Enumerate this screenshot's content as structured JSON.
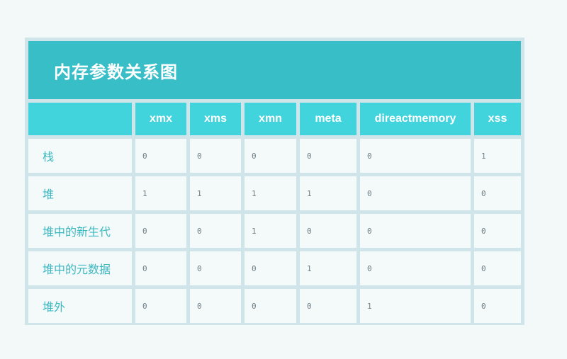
{
  "title": "内存参数关系图",
  "table": {
    "corner": "",
    "columns": [
      "xmx",
      "xms",
      "xmn",
      "meta",
      "direactmemory",
      "xss"
    ],
    "rows": [
      {
        "label": "栈",
        "values": [
          "0",
          "0",
          "0",
          "0",
          "0",
          "1"
        ]
      },
      {
        "label": "堆",
        "values": [
          "1",
          "1",
          "1",
          "1",
          "0",
          "0"
        ]
      },
      {
        "label": "堆中的新生代",
        "values": [
          "0",
          "0",
          "1",
          "0",
          "0",
          "0"
        ]
      },
      {
        "label": "堆中的元数据",
        "values": [
          "0",
          "0",
          "0",
          "1",
          "0",
          "0"
        ]
      },
      {
        "label": "堆外",
        "values": [
          "0",
          "0",
          "0",
          "0",
          "1",
          "0"
        ]
      }
    ]
  },
  "colors": {
    "page_background": "#f3f8f9",
    "title_bar": "#38bec6",
    "header_cells": "#41d4dd",
    "body_cells": "#f4f9fa",
    "grid_lines": "#cfe5ea",
    "row_label_text": "#3cb8c1",
    "value_text": "#6e7f86"
  }
}
